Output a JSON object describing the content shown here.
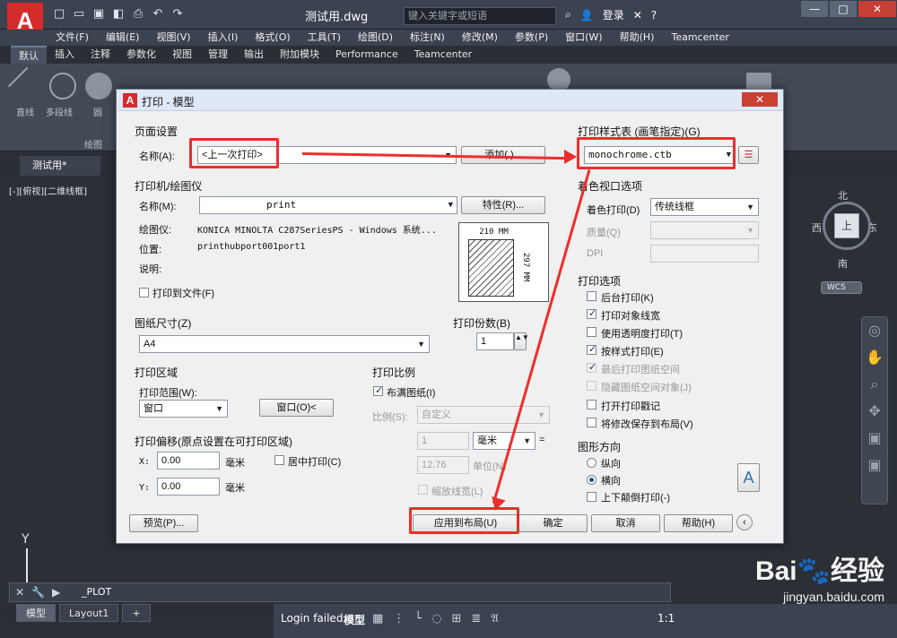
{
  "window": {
    "doc_title": "测试用.dwg",
    "search_placeholder": "键入关键字或短语",
    "login": "登录",
    "controls": [
      "—",
      "□",
      "✕"
    ]
  },
  "menu": [
    "文件(F)",
    "编辑(E)",
    "视图(V)",
    "插入(I)",
    "格式(O)",
    "工具(T)",
    "绘图(D)",
    "标注(N)",
    "修改(M)",
    "参数(P)",
    "窗口(W)",
    "帮助(H)",
    "Teamcenter"
  ],
  "ribbon": {
    "tabs": [
      "默认",
      "插入",
      "注释",
      "参数化",
      "视图",
      "管理",
      "输出",
      "附加模块",
      "Performance",
      "Teamcenter"
    ],
    "labels": {
      "line": "直线",
      "polyline": "多段线",
      "circle": "圆",
      "draw": "绘图"
    }
  },
  "drawing_tab": "测试用*",
  "viewport_label": "[-][俯视][二维线框]",
  "viewcube": {
    "north": "北",
    "west": "西",
    "east": "东",
    "south": "南",
    "face": "上",
    "wcs": "WCS"
  },
  "command_text": "_PLOT",
  "layout_tabs": [
    "模型",
    "Layout1",
    "+"
  ],
  "status": {
    "login_failed": "Login failed.",
    "model": "模型",
    "scale": "1:1"
  },
  "watermark": {
    "brand": "Bai🐾经验",
    "url": "jingyan.baidu.com"
  },
  "dialog": {
    "title": "打印 - 模型",
    "page_setup": {
      "title": "页面设置",
      "name_label": "名称(A):",
      "name_value": "<上一次打印>",
      "add_button": "添加(.)..."
    },
    "plot_style": {
      "title": "打印样式表 (画笔指定)(G)",
      "value": "monochrome.ctb"
    },
    "printer": {
      "title": "打印机/绘图仪",
      "name_label": "名称(M):",
      "name_value": "print",
      "properties_button": "特性(R)...",
      "plotter_label": "绘图仪:",
      "plotter_value": "KONICA MINOLTA C287SeriesPS - Windows 系统...",
      "location_label": "位置:",
      "location_value": "printhubport001port1",
      "description_label": "说明:",
      "print_to_file": "打印到文件(F)"
    },
    "preview": {
      "width": "210 MM",
      "height": "297 MM"
    },
    "shaded_viewport": {
      "title": "着色视口选项",
      "shaded_plot_label": "着色打印(D)",
      "shaded_plot_value": "传统线框",
      "quality_label": "质量(Q)",
      "dpi_label": "DPI"
    },
    "paper_size": {
      "title": "图纸尺寸(Z)",
      "value": "A4"
    },
    "copies": {
      "title": "打印份数(B)",
      "value": "1"
    },
    "plot_area": {
      "title": "打印区域",
      "range_label": "打印范围(W):",
      "range_value": "窗口",
      "window_button": "窗口(O)<"
    },
    "plot_scale": {
      "title": "打印比例",
      "fit_paper": "布满图纸(I)",
      "scale_label": "比例(S):",
      "scale_value": "自定义",
      "top_value": "1",
      "unit_value": "毫米",
      "bottom_value": "12.76",
      "unit_label": "单位(N)",
      "scale_lineweights": "缩放线宽(L)"
    },
    "plot_offset": {
      "title": "打印偏移(原点设置在可打印区域)",
      "x_label": "X:",
      "x_value": "0.00",
      "y_label": "Y:",
      "y_value": "0.00",
      "unit": "毫米",
      "center": "居中打印(C)"
    },
    "plot_options": {
      "title": "打印选项",
      "items": [
        "后台打印(K)",
        "打印对象线宽",
        "使用透明度打印(T)",
        "按样式打印(E)",
        "最后打印图纸空间",
        "隐藏图纸空间对象(J)",
        "打开打印戳记",
        "将修改保存到布局(V)"
      ]
    },
    "orientation": {
      "title": "图形方向",
      "portrait": "纵向",
      "landscape": "横向",
      "upside_down": "上下颠倒打印(-)"
    },
    "buttons": {
      "preview": "预览(P)...",
      "apply": "应用到布局(U)",
      "ok": "确定",
      "cancel": "取消",
      "help": "帮助(H)"
    }
  }
}
